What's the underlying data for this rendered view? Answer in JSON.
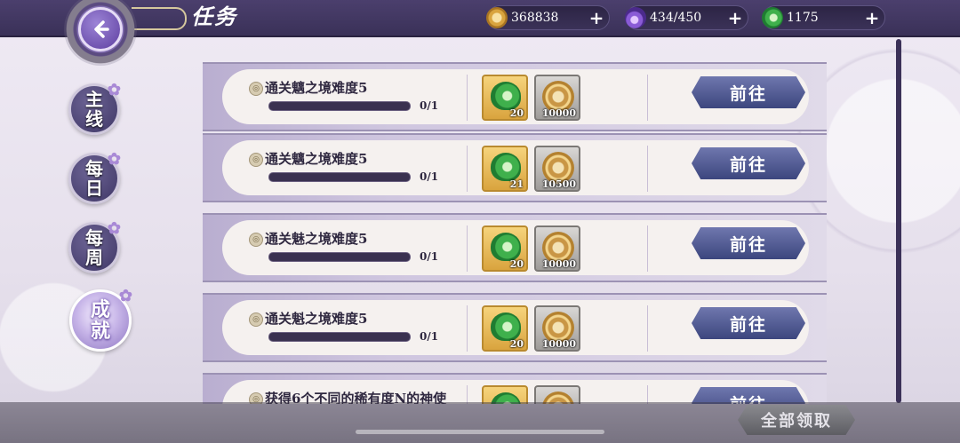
{
  "header": {
    "title": "任务",
    "resources": [
      {
        "icon": "coin-icon",
        "value": "368838",
        "color": "#d9a43e"
      },
      {
        "icon": "spirit-flame-icon",
        "value": "434/450",
        "color": "#8a5bd6"
      },
      {
        "icon": "jade-icon",
        "value": "1175",
        "color": "#3fb04c"
      }
    ]
  },
  "tabs": [
    {
      "label": "主线",
      "active": false
    },
    {
      "label": "每日",
      "active": false
    },
    {
      "label": "每周",
      "active": false
    },
    {
      "label": "成就",
      "active": true
    }
  ],
  "tasks": [
    {
      "name": "通关魑之境难度5",
      "progress_text": "0/1",
      "progress": 0,
      "rewards": [
        {
          "type": "jade",
          "qty": "20"
        },
        {
          "type": "coin",
          "qty": "10000"
        }
      ],
      "button": "前往"
    },
    {
      "name": "通关魑之境难度5",
      "progress_text": "0/1",
      "progress": 0,
      "rewards": [
        {
          "type": "jade",
          "qty": "21"
        },
        {
          "type": "coin",
          "qty": "10500"
        }
      ],
      "button": "前往"
    },
    {
      "name": "通关魅之境难度5",
      "progress_text": "0/1",
      "progress": 0,
      "rewards": [
        {
          "type": "jade",
          "qty": "20"
        },
        {
          "type": "coin",
          "qty": "10000"
        }
      ],
      "button": "前往"
    },
    {
      "name": "通关魁之境难度5",
      "progress_text": "0/1",
      "progress": 0,
      "rewards": [
        {
          "type": "jade",
          "qty": "20"
        },
        {
          "type": "coin",
          "qty": "10000"
        }
      ],
      "button": "前往"
    },
    {
      "name": "获得6个不同的稀有度N的神使",
      "progress_text": "",
      "progress": 0,
      "rewards": [
        {
          "type": "jade",
          "qty": ""
        },
        {
          "type": "coin",
          "qty": ""
        }
      ],
      "button": "前往"
    }
  ],
  "footer": {
    "claim_all": "全部领取"
  }
}
